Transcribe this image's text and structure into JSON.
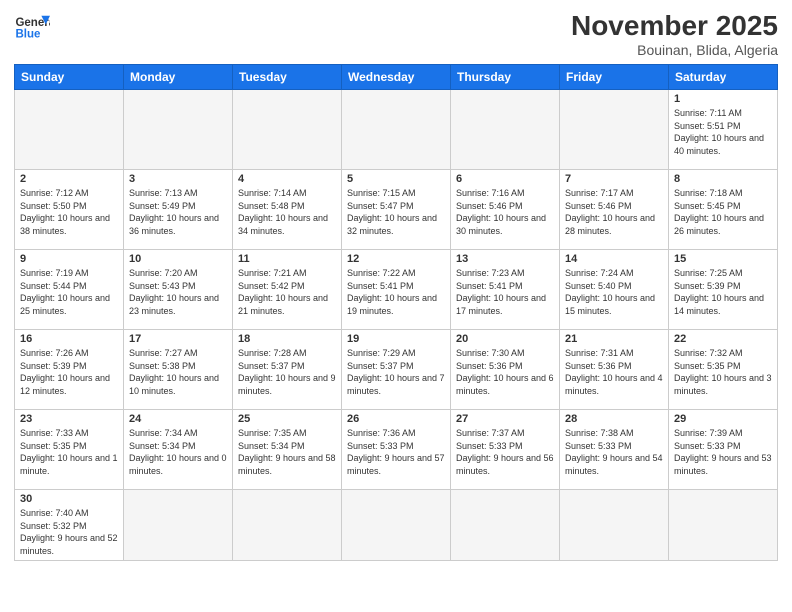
{
  "header": {
    "logo_general": "General",
    "logo_blue": "Blue",
    "month_title": "November 2025",
    "location": "Bouinan, Blida, Algeria"
  },
  "days_of_week": [
    "Sunday",
    "Monday",
    "Tuesday",
    "Wednesday",
    "Thursday",
    "Friday",
    "Saturday"
  ],
  "weeks": [
    [
      {
        "day": "",
        "info": ""
      },
      {
        "day": "",
        "info": ""
      },
      {
        "day": "",
        "info": ""
      },
      {
        "day": "",
        "info": ""
      },
      {
        "day": "",
        "info": ""
      },
      {
        "day": "",
        "info": ""
      },
      {
        "day": "1",
        "info": "Sunrise: 7:11 AM\nSunset: 5:51 PM\nDaylight: 10 hours and 40 minutes."
      }
    ],
    [
      {
        "day": "2",
        "info": "Sunrise: 7:12 AM\nSunset: 5:50 PM\nDaylight: 10 hours and 38 minutes."
      },
      {
        "day": "3",
        "info": "Sunrise: 7:13 AM\nSunset: 5:49 PM\nDaylight: 10 hours and 36 minutes."
      },
      {
        "day": "4",
        "info": "Sunrise: 7:14 AM\nSunset: 5:48 PM\nDaylight: 10 hours and 34 minutes."
      },
      {
        "day": "5",
        "info": "Sunrise: 7:15 AM\nSunset: 5:47 PM\nDaylight: 10 hours and 32 minutes."
      },
      {
        "day": "6",
        "info": "Sunrise: 7:16 AM\nSunset: 5:46 PM\nDaylight: 10 hours and 30 minutes."
      },
      {
        "day": "7",
        "info": "Sunrise: 7:17 AM\nSunset: 5:46 PM\nDaylight: 10 hours and 28 minutes."
      },
      {
        "day": "8",
        "info": "Sunrise: 7:18 AM\nSunset: 5:45 PM\nDaylight: 10 hours and 26 minutes."
      }
    ],
    [
      {
        "day": "9",
        "info": "Sunrise: 7:19 AM\nSunset: 5:44 PM\nDaylight: 10 hours and 25 minutes."
      },
      {
        "day": "10",
        "info": "Sunrise: 7:20 AM\nSunset: 5:43 PM\nDaylight: 10 hours and 23 minutes."
      },
      {
        "day": "11",
        "info": "Sunrise: 7:21 AM\nSunset: 5:42 PM\nDaylight: 10 hours and 21 minutes."
      },
      {
        "day": "12",
        "info": "Sunrise: 7:22 AM\nSunset: 5:41 PM\nDaylight: 10 hours and 19 minutes."
      },
      {
        "day": "13",
        "info": "Sunrise: 7:23 AM\nSunset: 5:41 PM\nDaylight: 10 hours and 17 minutes."
      },
      {
        "day": "14",
        "info": "Sunrise: 7:24 AM\nSunset: 5:40 PM\nDaylight: 10 hours and 15 minutes."
      },
      {
        "day": "15",
        "info": "Sunrise: 7:25 AM\nSunset: 5:39 PM\nDaylight: 10 hours and 14 minutes."
      }
    ],
    [
      {
        "day": "16",
        "info": "Sunrise: 7:26 AM\nSunset: 5:39 PM\nDaylight: 10 hours and 12 minutes."
      },
      {
        "day": "17",
        "info": "Sunrise: 7:27 AM\nSunset: 5:38 PM\nDaylight: 10 hours and 10 minutes."
      },
      {
        "day": "18",
        "info": "Sunrise: 7:28 AM\nSunset: 5:37 PM\nDaylight: 10 hours and 9 minutes."
      },
      {
        "day": "19",
        "info": "Sunrise: 7:29 AM\nSunset: 5:37 PM\nDaylight: 10 hours and 7 minutes."
      },
      {
        "day": "20",
        "info": "Sunrise: 7:30 AM\nSunset: 5:36 PM\nDaylight: 10 hours and 6 minutes."
      },
      {
        "day": "21",
        "info": "Sunrise: 7:31 AM\nSunset: 5:36 PM\nDaylight: 10 hours and 4 minutes."
      },
      {
        "day": "22",
        "info": "Sunrise: 7:32 AM\nSunset: 5:35 PM\nDaylight: 10 hours and 3 minutes."
      }
    ],
    [
      {
        "day": "23",
        "info": "Sunrise: 7:33 AM\nSunset: 5:35 PM\nDaylight: 10 hours and 1 minute."
      },
      {
        "day": "24",
        "info": "Sunrise: 7:34 AM\nSunset: 5:34 PM\nDaylight: 10 hours and 0 minutes."
      },
      {
        "day": "25",
        "info": "Sunrise: 7:35 AM\nSunset: 5:34 PM\nDaylight: 9 hours and 58 minutes."
      },
      {
        "day": "26",
        "info": "Sunrise: 7:36 AM\nSunset: 5:33 PM\nDaylight: 9 hours and 57 minutes."
      },
      {
        "day": "27",
        "info": "Sunrise: 7:37 AM\nSunset: 5:33 PM\nDaylight: 9 hours and 56 minutes."
      },
      {
        "day": "28",
        "info": "Sunrise: 7:38 AM\nSunset: 5:33 PM\nDaylight: 9 hours and 54 minutes."
      },
      {
        "day": "29",
        "info": "Sunrise: 7:39 AM\nSunset: 5:33 PM\nDaylight: 9 hours and 53 minutes."
      }
    ],
    [
      {
        "day": "30",
        "info": "Sunrise: 7:40 AM\nSunset: 5:32 PM\nDaylight: 9 hours and 52 minutes."
      },
      {
        "day": "",
        "info": ""
      },
      {
        "day": "",
        "info": ""
      },
      {
        "day": "",
        "info": ""
      },
      {
        "day": "",
        "info": ""
      },
      {
        "day": "",
        "info": ""
      },
      {
        "day": "",
        "info": ""
      }
    ]
  ]
}
